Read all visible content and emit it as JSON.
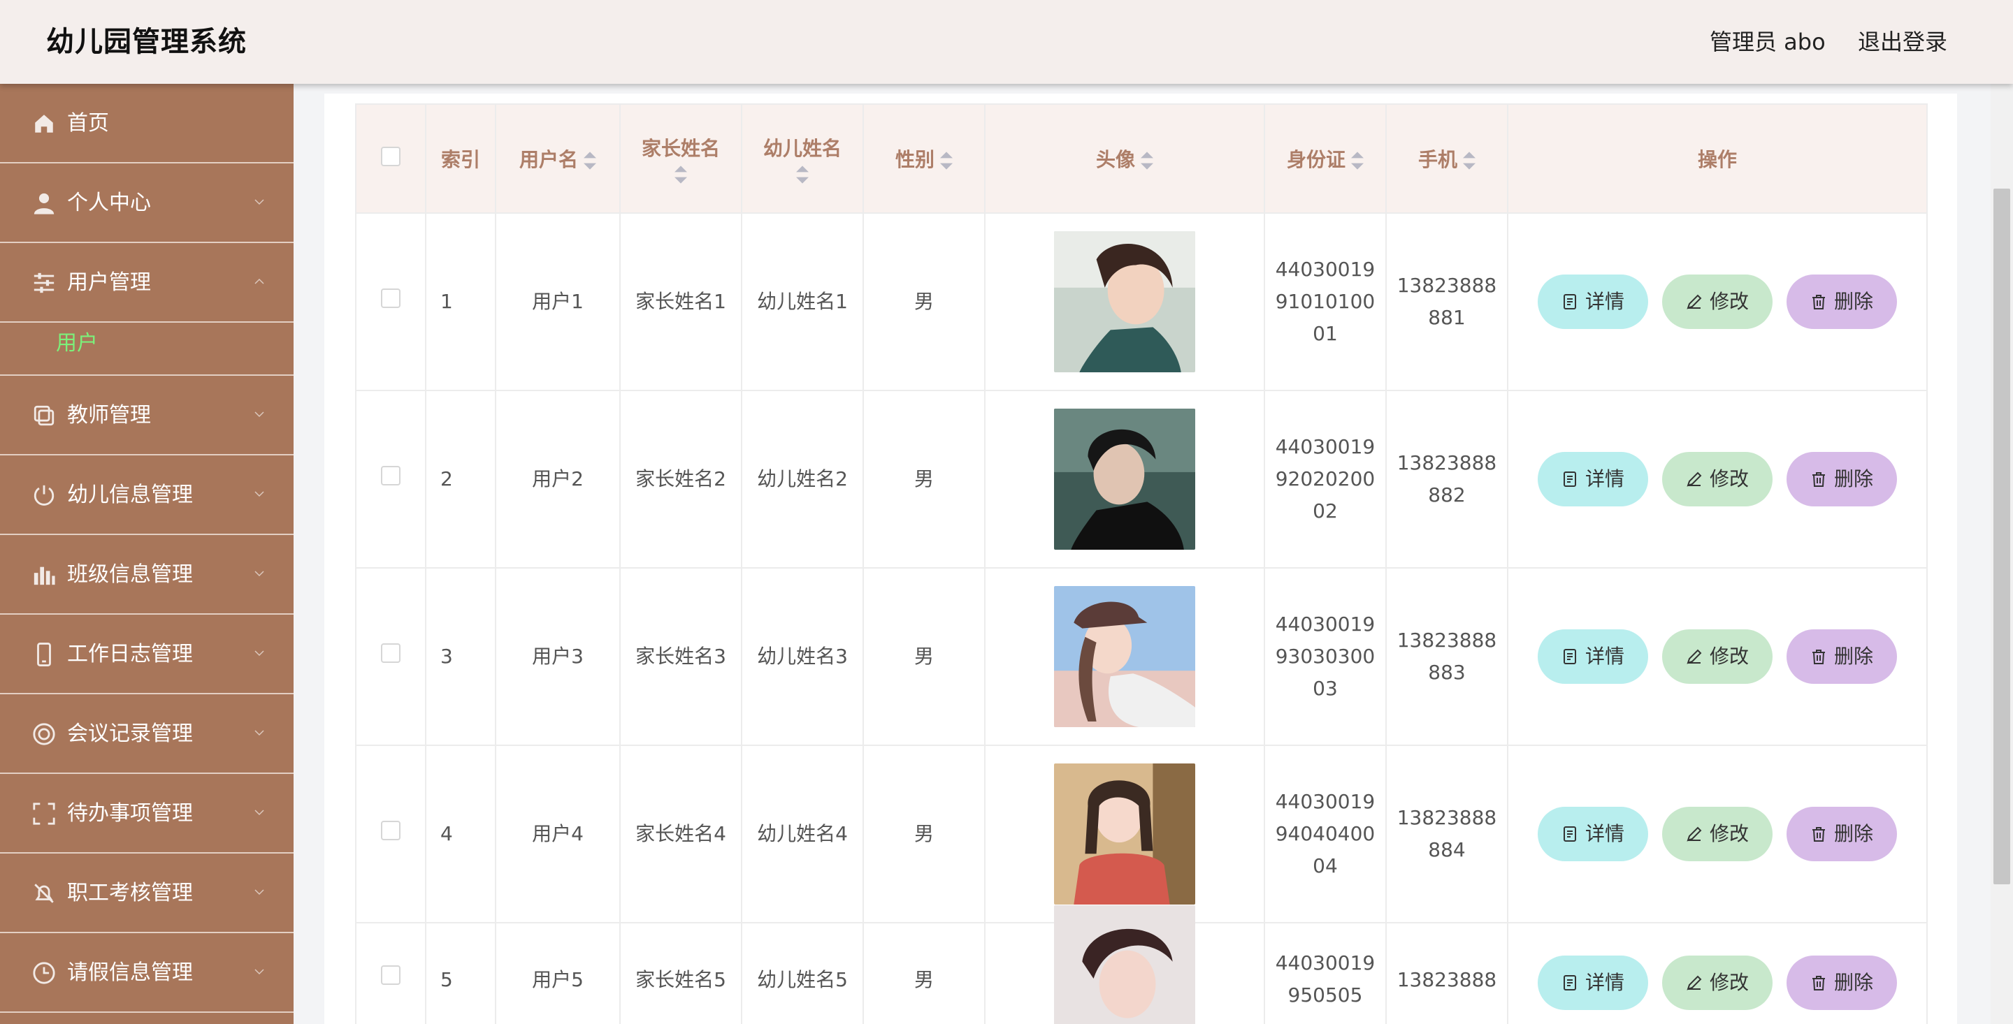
{
  "header": {
    "title": "幼儿园管理系统",
    "user": "管理员 abo",
    "logout": "退出登录"
  },
  "sidebar": {
    "items": [
      {
        "label": "首页",
        "icon": "home-icon"
      },
      {
        "label": "个人中心",
        "icon": "user-icon"
      },
      {
        "label": "用户管理",
        "icon": "sliders-icon",
        "expanded": true,
        "children": [
          {
            "label": "用户"
          }
        ]
      },
      {
        "label": "教师管理",
        "icon": "copy-icon"
      },
      {
        "label": "幼儿信息管理",
        "icon": "power-icon"
      },
      {
        "label": "班级信息管理",
        "icon": "bar-chart-icon"
      },
      {
        "label": "工作日志管理",
        "icon": "phone-icon"
      },
      {
        "label": "会议记录管理",
        "icon": "lifebuoy-icon"
      },
      {
        "label": "待办事项管理",
        "icon": "frame-icon"
      },
      {
        "label": "职工考核管理",
        "icon": "bell-off-icon"
      },
      {
        "label": "请假信息管理",
        "icon": "clock-icon"
      }
    ]
  },
  "table": {
    "columns": [
      "索引",
      "用户名",
      "家长姓名",
      "幼儿姓名",
      "性别",
      "头像",
      "身份证",
      "手机",
      "操作"
    ],
    "rows": [
      {
        "index": "1",
        "username": "用户1",
        "parent": "家长姓名1",
        "child": "幼儿姓名1",
        "gender": "男",
        "id_card": "440300199101010001",
        "phone": "13823888881"
      },
      {
        "index": "2",
        "username": "用户2",
        "parent": "家长姓名2",
        "child": "幼儿姓名2",
        "gender": "男",
        "id_card": "440300199202020002",
        "phone": "13823888882"
      },
      {
        "index": "3",
        "username": "用户3",
        "parent": "家长姓名3",
        "child": "幼儿姓名3",
        "gender": "男",
        "id_card": "440300199303030003",
        "phone": "13823888883"
      },
      {
        "index": "4",
        "username": "用户4",
        "parent": "家长姓名4",
        "child": "幼儿姓名4",
        "gender": "男",
        "id_card": "440300199404040004",
        "phone": "13823888884"
      },
      {
        "index": "5",
        "username": "用户5",
        "parent": "家长姓名5",
        "child": "幼儿姓名5",
        "gender": "男",
        "id_card": "44030019950505",
        "phone": "13823888"
      }
    ],
    "actions": {
      "detail": "详情",
      "edit": "修改",
      "delete": "删除"
    }
  },
  "colors": {
    "sidebar": "#a8765a",
    "header_bg": "#f4eeec",
    "th_text": "#ad7e68",
    "active_sub": "#7cf07a",
    "btn_detail": "#b8eeee",
    "btn_edit": "#c8e8cc",
    "btn_delete": "#d7bbe8"
  }
}
